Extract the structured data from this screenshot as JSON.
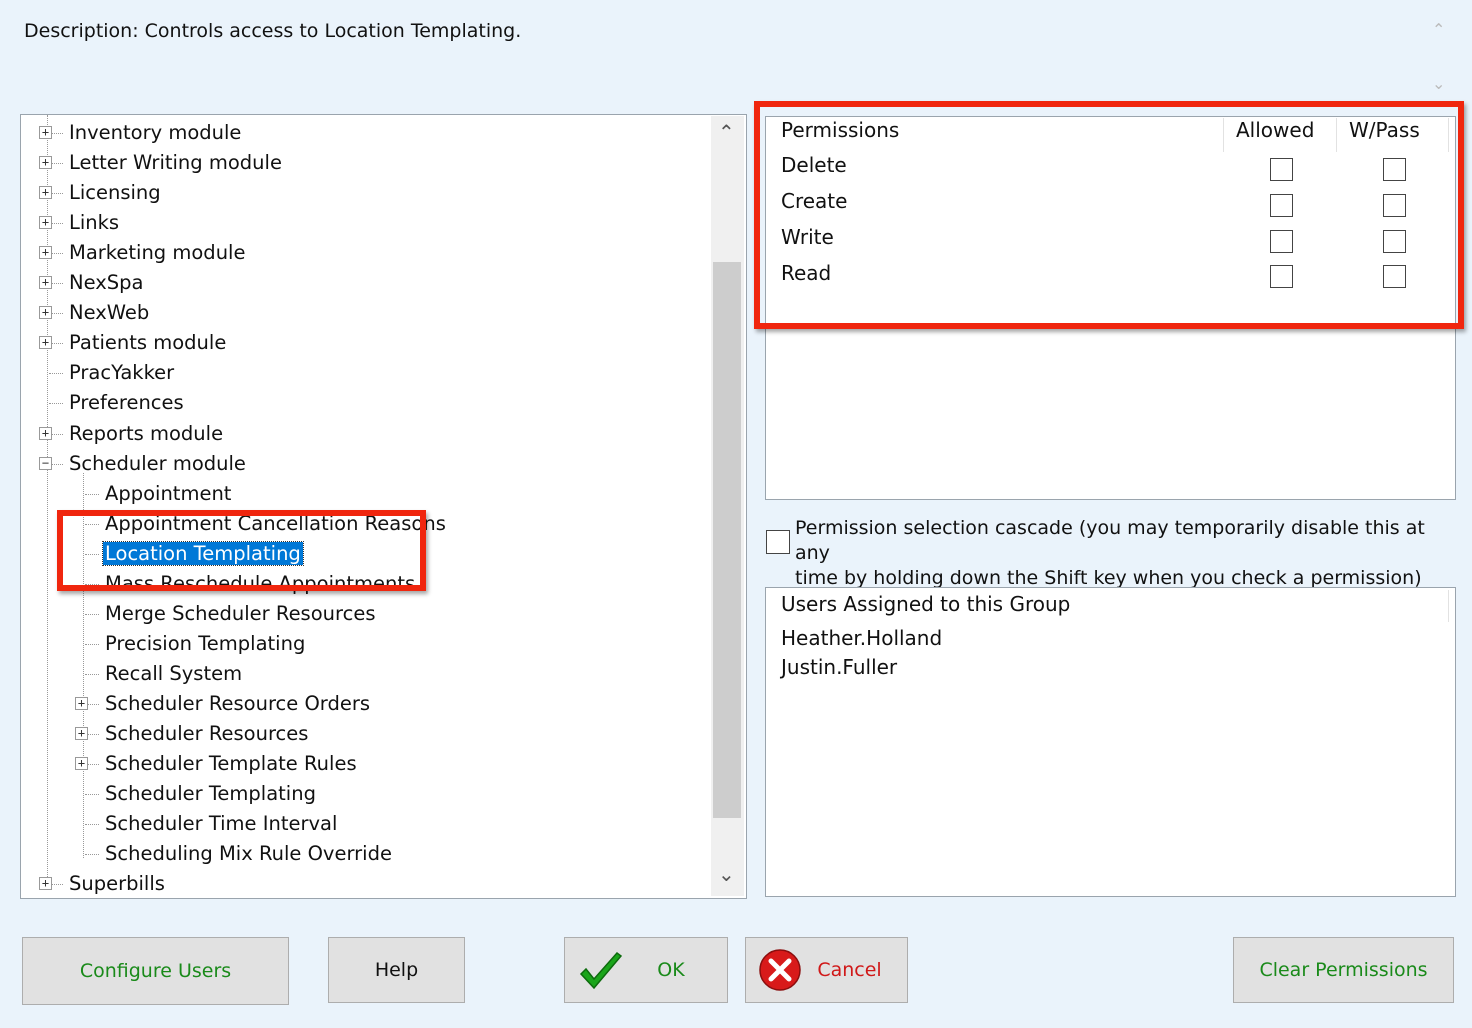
{
  "description": "Description: Controls access to Location Templating.",
  "tree": {
    "items": [
      {
        "label": "Inventory module",
        "level": 0,
        "expander": "+"
      },
      {
        "label": "Letter Writing module",
        "level": 0,
        "expander": "+"
      },
      {
        "label": "Licensing",
        "level": 0,
        "expander": "+"
      },
      {
        "label": "Links",
        "level": 0,
        "expander": "+"
      },
      {
        "label": "Marketing module",
        "level": 0,
        "expander": "+"
      },
      {
        "label": "NexSpa",
        "level": 0,
        "expander": "+"
      },
      {
        "label": "NexWeb",
        "level": 0,
        "expander": "+"
      },
      {
        "label": "Patients module",
        "level": 0,
        "expander": "+"
      },
      {
        "label": "PracYakker",
        "level": 0,
        "expander": ""
      },
      {
        "label": "Preferences",
        "level": 0,
        "expander": ""
      },
      {
        "label": "Reports module",
        "level": 0,
        "expander": "+"
      },
      {
        "label": "Scheduler module",
        "level": 0,
        "expander": "−"
      },
      {
        "label": "Appointment",
        "level": 1,
        "expander": ""
      },
      {
        "label": "Appointment Cancellation Reasons",
        "level": 1,
        "expander": ""
      },
      {
        "label": "Location Templating",
        "level": 1,
        "expander": "",
        "selected": true
      },
      {
        "label": "Mass Reschedule Appointments",
        "level": 1,
        "expander": ""
      },
      {
        "label": "Merge Scheduler Resources",
        "level": 1,
        "expander": ""
      },
      {
        "label": "Precision Templating",
        "level": 1,
        "expander": ""
      },
      {
        "label": "Recall System",
        "level": 1,
        "expander": ""
      },
      {
        "label": "Scheduler Resource Orders",
        "level": 1,
        "expander": "+"
      },
      {
        "label": "Scheduler Resources",
        "level": 1,
        "expander": "+"
      },
      {
        "label": "Scheduler Template Rules",
        "level": 1,
        "expander": "+"
      },
      {
        "label": "Scheduler Templating",
        "level": 1,
        "expander": ""
      },
      {
        "label": "Scheduler Time Interval",
        "level": 1,
        "expander": ""
      },
      {
        "label": "Scheduling Mix Rule Override",
        "level": 1,
        "expander": ""
      },
      {
        "label": "Superbills",
        "level": 0,
        "expander": "+"
      }
    ]
  },
  "permissions": {
    "header": {
      "name": "Permissions",
      "allowed": "Allowed",
      "wpass": "W/Pass"
    },
    "rows": [
      {
        "name": "Delete",
        "allowed": false,
        "wpass": false
      },
      {
        "name": "Create",
        "allowed": false,
        "wpass": false
      },
      {
        "name": "Write",
        "allowed": false,
        "wpass": false
      },
      {
        "name": "Read",
        "allowed": false,
        "wpass": false
      }
    ]
  },
  "cascade": {
    "line1": "Permission selection cascade (you may temporarily disable this at any",
    "line2": "time by holding down the Shift key when you check a permission)",
    "checked": false
  },
  "users": {
    "title": "Users Assigned to this Group",
    "list": [
      "Heather.Holland",
      "Justin.Fuller"
    ]
  },
  "buttons": {
    "configure_users": "Configure Users",
    "help": "Help",
    "ok": "OK",
    "cancel": "Cancel",
    "clear_permissions": "Clear Permissions"
  },
  "colors": {
    "green_text": "#1a8a1a",
    "red_text": "#d01818",
    "selection": "#0078d7",
    "highlight": "#f0260e"
  }
}
